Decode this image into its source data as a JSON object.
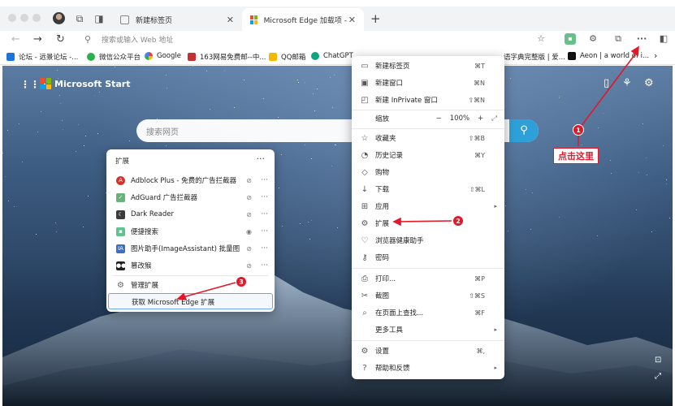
{
  "tabs": [
    {
      "label": "新建标签页",
      "active": false
    },
    {
      "label": "Microsoft Edge 加载项 - image",
      "active": true
    }
  ],
  "address": {
    "placeholder": "搜索或输入 Web 地址"
  },
  "bookmarks": [
    {
      "label": "论坛 - 远景论坛 -...",
      "color": "#1e73d8"
    },
    {
      "label": "微信公众平台",
      "color": "#2bb24c"
    },
    {
      "label": "Google",
      "color": "#4285f4"
    },
    {
      "label": "163网易免费邮--中...",
      "color": "#c62f2f"
    },
    {
      "label": "QQ邮箱",
      "color": "#f5b800"
    },
    {
      "label": "ChatGPT",
      "color": "#10a37f"
    },
    {
      "label": "语字典完整版 | 爱...",
      "color": "#666666"
    },
    {
      "label": "Aeon | a world of i...",
      "color": "#111111"
    }
  ],
  "page": {
    "brand": "Microsoft Start",
    "search_placeholder": "搜索网页"
  },
  "extensions_popup": {
    "title": "扩展",
    "items": [
      {
        "name": "Adblock Plus - 免费的广告拦截器",
        "icon": "abp-icon",
        "color": "#d9302c",
        "visibility": "hidden"
      },
      {
        "name": "AdGuard 广告拦截器",
        "icon": "adguard-icon",
        "color": "#67b279",
        "visibility": "hidden"
      },
      {
        "name": "Dark Reader",
        "icon": "dark-reader-icon",
        "color": "#3c3c3c",
        "visibility": "hidden"
      },
      {
        "name": "便捷搜索",
        "icon": "search-ext-icon",
        "color": "#5fc38f",
        "visibility": "shown"
      },
      {
        "name": "图片助手(ImageAssistant) 批量图...",
        "icon": "image-assistant-icon",
        "color": "#3a6fc4",
        "visibility": "hidden"
      },
      {
        "name": "篡改猴",
        "icon": "tampermonkey-icon",
        "color": "#222222",
        "visibility": "hidden"
      }
    ],
    "manage_label": "管理扩展",
    "get_label": "获取 Microsoft Edge 扩展"
  },
  "edge_menu": {
    "items": [
      {
        "label": "新建标签页",
        "shortcut": "⌘T",
        "icon": "new-tab-icon"
      },
      {
        "label": "新建窗口",
        "shortcut": "⌘N",
        "icon": "new-window-icon"
      },
      {
        "label": "新建 InPrivate 窗口",
        "shortcut": "⇧⌘N",
        "icon": "inprivate-icon"
      },
      {
        "label": "缩放",
        "shortcut": "",
        "icon": "zoom-icon",
        "zoom": "100%"
      },
      {
        "label": "收藏夹",
        "shortcut": "⇧⌘B",
        "icon": "favorites-icon"
      },
      {
        "label": "历史记录",
        "shortcut": "⌘Y",
        "icon": "history-icon"
      },
      {
        "label": "购物",
        "shortcut": "",
        "icon": "shopping-icon"
      },
      {
        "label": "下载",
        "shortcut": "⇧⌘L",
        "icon": "download-icon"
      },
      {
        "label": "应用",
        "shortcut": "",
        "icon": "apps-icon",
        "submenu": true
      },
      {
        "label": "扩展",
        "shortcut": "",
        "icon": "extensions-icon"
      },
      {
        "label": "浏览器健康助手",
        "shortcut": "",
        "icon": "health-icon"
      },
      {
        "label": "密码",
        "shortcut": "",
        "icon": "password-icon"
      },
      {
        "label": "打印...",
        "shortcut": "⌘P",
        "icon": "print-icon"
      },
      {
        "label": "截图",
        "shortcut": "⇧⌘S",
        "icon": "screenshot-icon"
      },
      {
        "label": "在页面上查找...",
        "shortcut": "⌘F",
        "icon": "find-icon"
      },
      {
        "label": "更多工具",
        "shortcut": "",
        "icon": "more-tools-icon",
        "submenu": true
      },
      {
        "label": "设置",
        "shortcut": "⌘,",
        "icon": "settings-icon"
      },
      {
        "label": "帮助和反馈",
        "shortcut": "",
        "icon": "help-icon",
        "submenu": true
      }
    ]
  },
  "annotations": {
    "badges": [
      "1",
      "2",
      "3"
    ],
    "callout": "点击这里",
    "color": "#e0182a"
  }
}
